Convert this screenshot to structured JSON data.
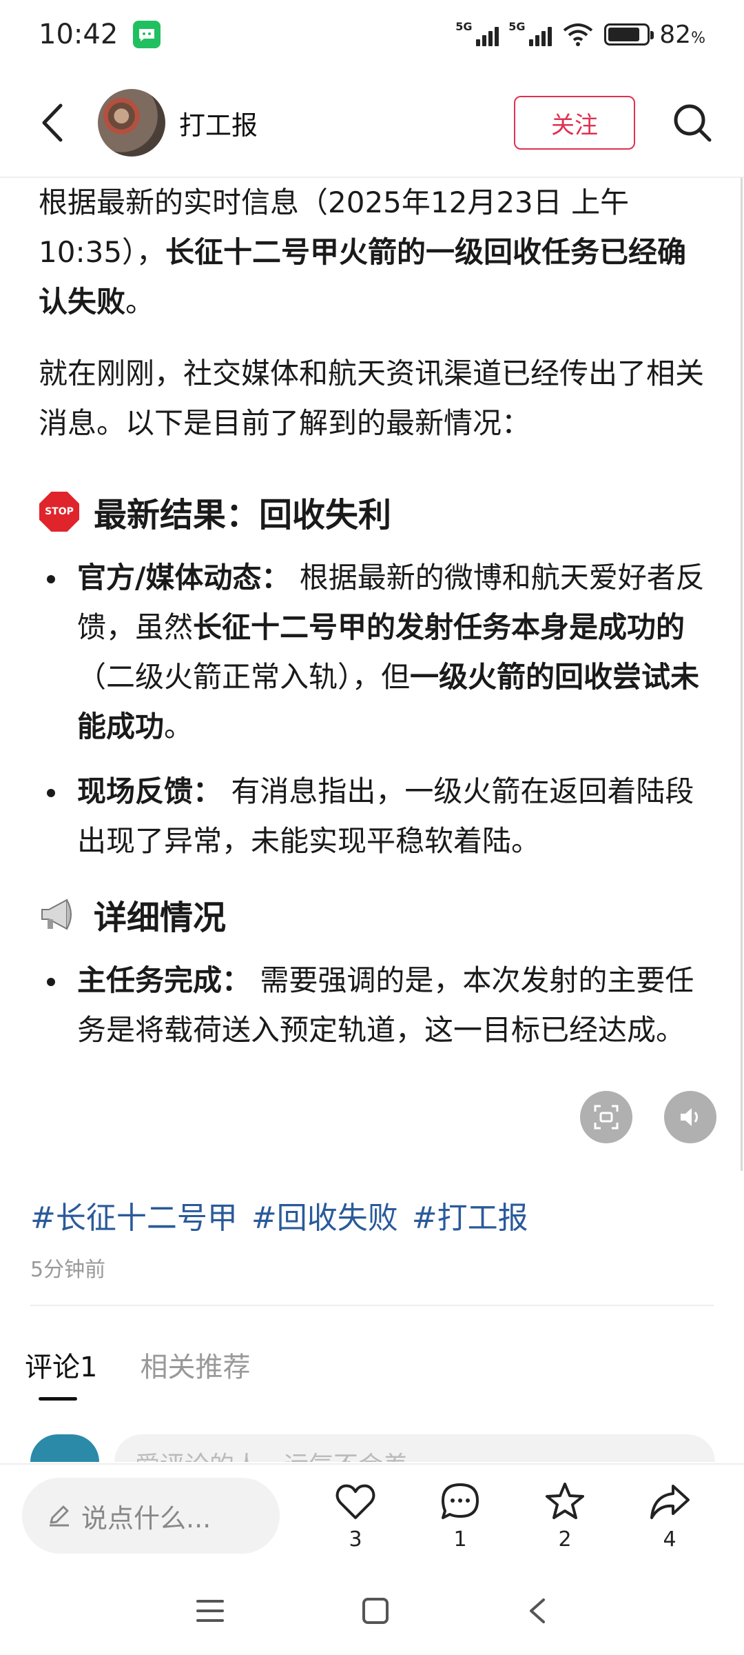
{
  "status_bar": {
    "time": "10:42",
    "net1": "5G",
    "net2": "5G",
    "battery_level": 0.82,
    "battery_percent": "82",
    "battery_unit": "%"
  },
  "header": {
    "account_name": "打工报",
    "follow_label": "关注"
  },
  "article": {
    "p1_a": "根据最新的实时信息（2025年12月23日 上午10:35），",
    "p1_b": "长征十二号甲火箭的一级回收任务已经确认失败",
    "p1_c": "。",
    "p2": "就在刚刚，社交媒体和航天资讯渠道已经传出了相关消息。以下是目前了解到的最新情况：",
    "section1": {
      "icon_text": "STOP",
      "title": "最新结果：回收失利",
      "bullets": [
        {
          "label": "官方/媒体动态：",
          "t1": " 根据最新的微博和航天爱好者反馈，虽然",
          "b1": "长征十二号甲的发射任务本身是成功的",
          "t2": "（二级火箭正常入轨），但",
          "b2": "一级火箭的回收尝试未能成功",
          "t3": "。"
        },
        {
          "label": "现场反馈：",
          "t1": " 有消息指出，一级火箭在返回着陆段出现了异常，未能实现平稳软着陆。"
        }
      ]
    },
    "section2": {
      "title": "详细情况",
      "bullets": [
        {
          "label": "主任务完成：",
          "t1": " 需要强调的是，本次发射的主要任务是将载荷送入预定轨道，这一目标已经达成。"
        }
      ]
    }
  },
  "tags": [
    "#长征十二号甲",
    "#回收失败",
    "#打工报"
  ],
  "post_time": "5分钟前",
  "comment_tabs": [
    "评论1",
    "相关推荐"
  ],
  "comment_input_placeholder": "爱评论的人，运气不会差",
  "bottom_bar": {
    "input_placeholder": "说点什么...",
    "like_count": "3",
    "comment_count": "1",
    "favorite_count": "2",
    "share_count": "4"
  },
  "colors": {
    "accent": "#e03050",
    "tag": "#2a5a9a"
  }
}
